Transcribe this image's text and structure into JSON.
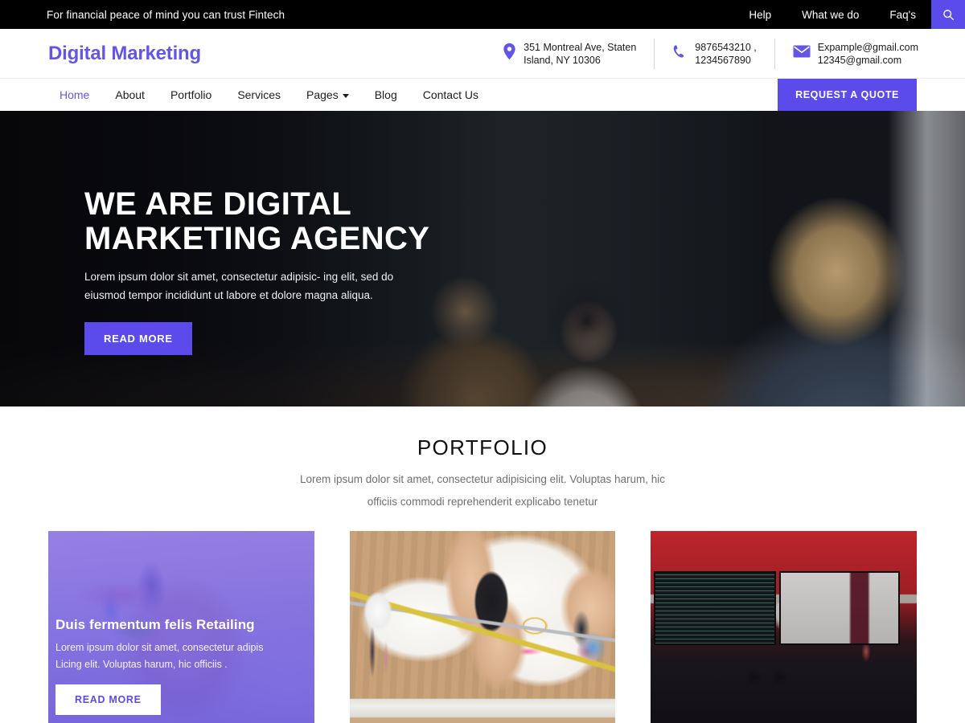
{
  "topbar": {
    "tagline": "For financial peace of mind you can trust Fintech",
    "links": [
      {
        "label": "Help"
      },
      {
        "label": "What we do"
      },
      {
        "label": "Faq's"
      }
    ],
    "search_icon": "search-icon"
  },
  "header": {
    "logo": "Digital Marketing",
    "contacts": [
      {
        "icon": "location-pin-icon",
        "line1": "351 Montreal Ave, Staten",
        "line2": "Island, NY 10306"
      },
      {
        "icon": "phone-icon",
        "line1": "9876543210 ,",
        "line2": "1234567890"
      },
      {
        "icon": "envelope-icon",
        "line1": "Expample@gmail.com",
        "line2": "12345@gmail.com"
      }
    ]
  },
  "nav": {
    "items": [
      {
        "label": "Home",
        "active": true,
        "dropdown": false
      },
      {
        "label": "About",
        "active": false,
        "dropdown": false
      },
      {
        "label": "Portfolio",
        "active": false,
        "dropdown": false
      },
      {
        "label": "Services",
        "active": false,
        "dropdown": false
      },
      {
        "label": "Pages",
        "active": false,
        "dropdown": true
      },
      {
        "label": "Blog",
        "active": false,
        "dropdown": false
      },
      {
        "label": "Contact Us",
        "active": false,
        "dropdown": false
      }
    ],
    "quote_button": "REQUEST A QUOTE"
  },
  "hero": {
    "title_line1": "WE ARE DIGITAL",
    "title_line2": "MARKETING AGENCY",
    "subtitle": "Lorem ipsum dolor sit amet, consectetur adipisic- ing elit, sed  do eiusmod tempor incididunt ut labore et dolore magna aliqua.",
    "cta": "READ MORE"
  },
  "portfolio": {
    "title": "PORTFOLIO",
    "subtitle": "Lorem ipsum dolor sit amet, consectetur adipisicing elit. Voluptas harum, hic officiis commodi reprehenderit explicabo tenetur",
    "cards": [
      {
        "title": "Duis fermentum felis Retailing",
        "text_line1": "Lorem ipsum dolor sit amet, consectetur adipis",
        "text_line2": "Licing elit. Voluptas harum, hic officiis .",
        "button": "READ MORE",
        "image_alt": "hands-writing-with-highlighters"
      },
      {
        "image_alt": "top-down-desk-with-papers-phone-and-hands"
      },
      {
        "image_alt": "dual-monitor-desk-setup-with-code"
      }
    ]
  },
  "colors": {
    "accent": "#5b4bea",
    "logo": "#6355e6",
    "topbar_bg": "#000000",
    "card_overlay": "#7c63e4"
  }
}
